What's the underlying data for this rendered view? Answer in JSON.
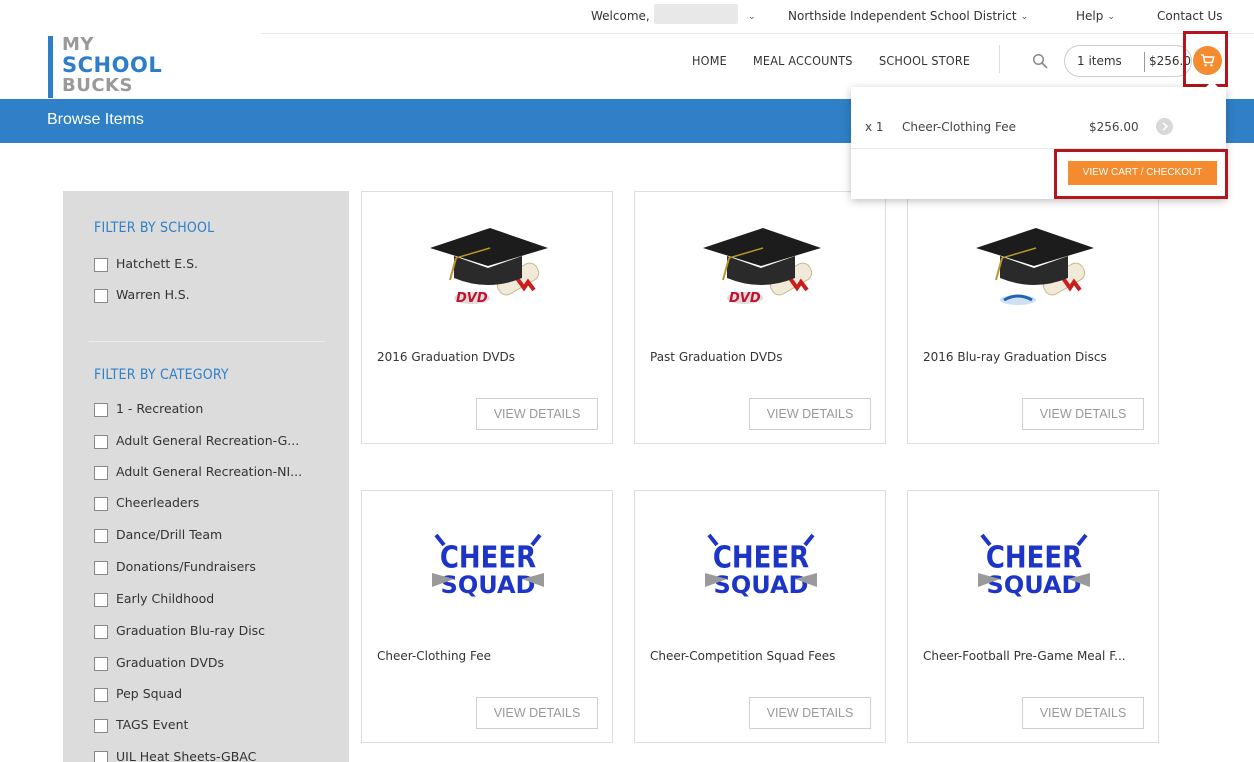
{
  "utility": {
    "welcome": "Welcome,",
    "district": "Northside Independent School District",
    "help": "Help",
    "contact": "Contact Us"
  },
  "logo": {
    "line1": "MY",
    "line2": "SCHOOL",
    "line3": "BUCKS"
  },
  "nav": {
    "home": "HOME",
    "meal_accounts": "MEAL ACCOUNTS",
    "school_store": "SCHOOL STORE"
  },
  "cart": {
    "items_label": "1 items",
    "total": "$256.00",
    "dropdown": {
      "qty": "x 1",
      "name": "Cheer-Clothing Fee",
      "price": "$256.00",
      "checkout_label": "VIEW CART / CHECKOUT"
    }
  },
  "page": {
    "title": "Browse Items"
  },
  "filters": {
    "school_title": "FILTER BY SCHOOL",
    "schools": [
      "Hatchett E.S.",
      "Warren H.S."
    ],
    "category_title": "FILTER BY CATEGORY",
    "categories": [
      "1 - Recreation",
      "Adult General Recreation-G...",
      "Adult General Recreation-NI...",
      "Cheerleaders",
      "Dance/Drill Team",
      "Donations/Fundraisers",
      "Early Childhood",
      "Graduation Blu-ray Disc",
      "Graduation DVDs",
      "Pep Squad",
      "TAGS Event",
      "UIL Heat Sheets-GBAC"
    ]
  },
  "products": [
    {
      "name": "2016 Graduation DVDs",
      "image": "graduation-cap-dvd",
      "button": "VIEW DETAILS"
    },
    {
      "name": "Past Graduation DVDs",
      "image": "graduation-cap-dvd",
      "button": "VIEW DETAILS"
    },
    {
      "name": "2016 Blu-ray Graduation Discs",
      "image": "graduation-cap-bluray",
      "button": "VIEW DETAILS"
    },
    {
      "name": "Cheer-Clothing Fee",
      "image": "cheer-squad-logo",
      "button": "VIEW DETAILS"
    },
    {
      "name": "Cheer-Competition Squad Fees",
      "image": "cheer-squad-logo",
      "button": "VIEW DETAILS"
    },
    {
      "name": "Cheer-Football Pre-Game Meal F...",
      "image": "cheer-squad-logo",
      "button": "VIEW DETAILS"
    }
  ],
  "colors": {
    "accent": "#2f80c6",
    "cart_orange": "#f58b2f",
    "highlight": "#b3161d"
  }
}
